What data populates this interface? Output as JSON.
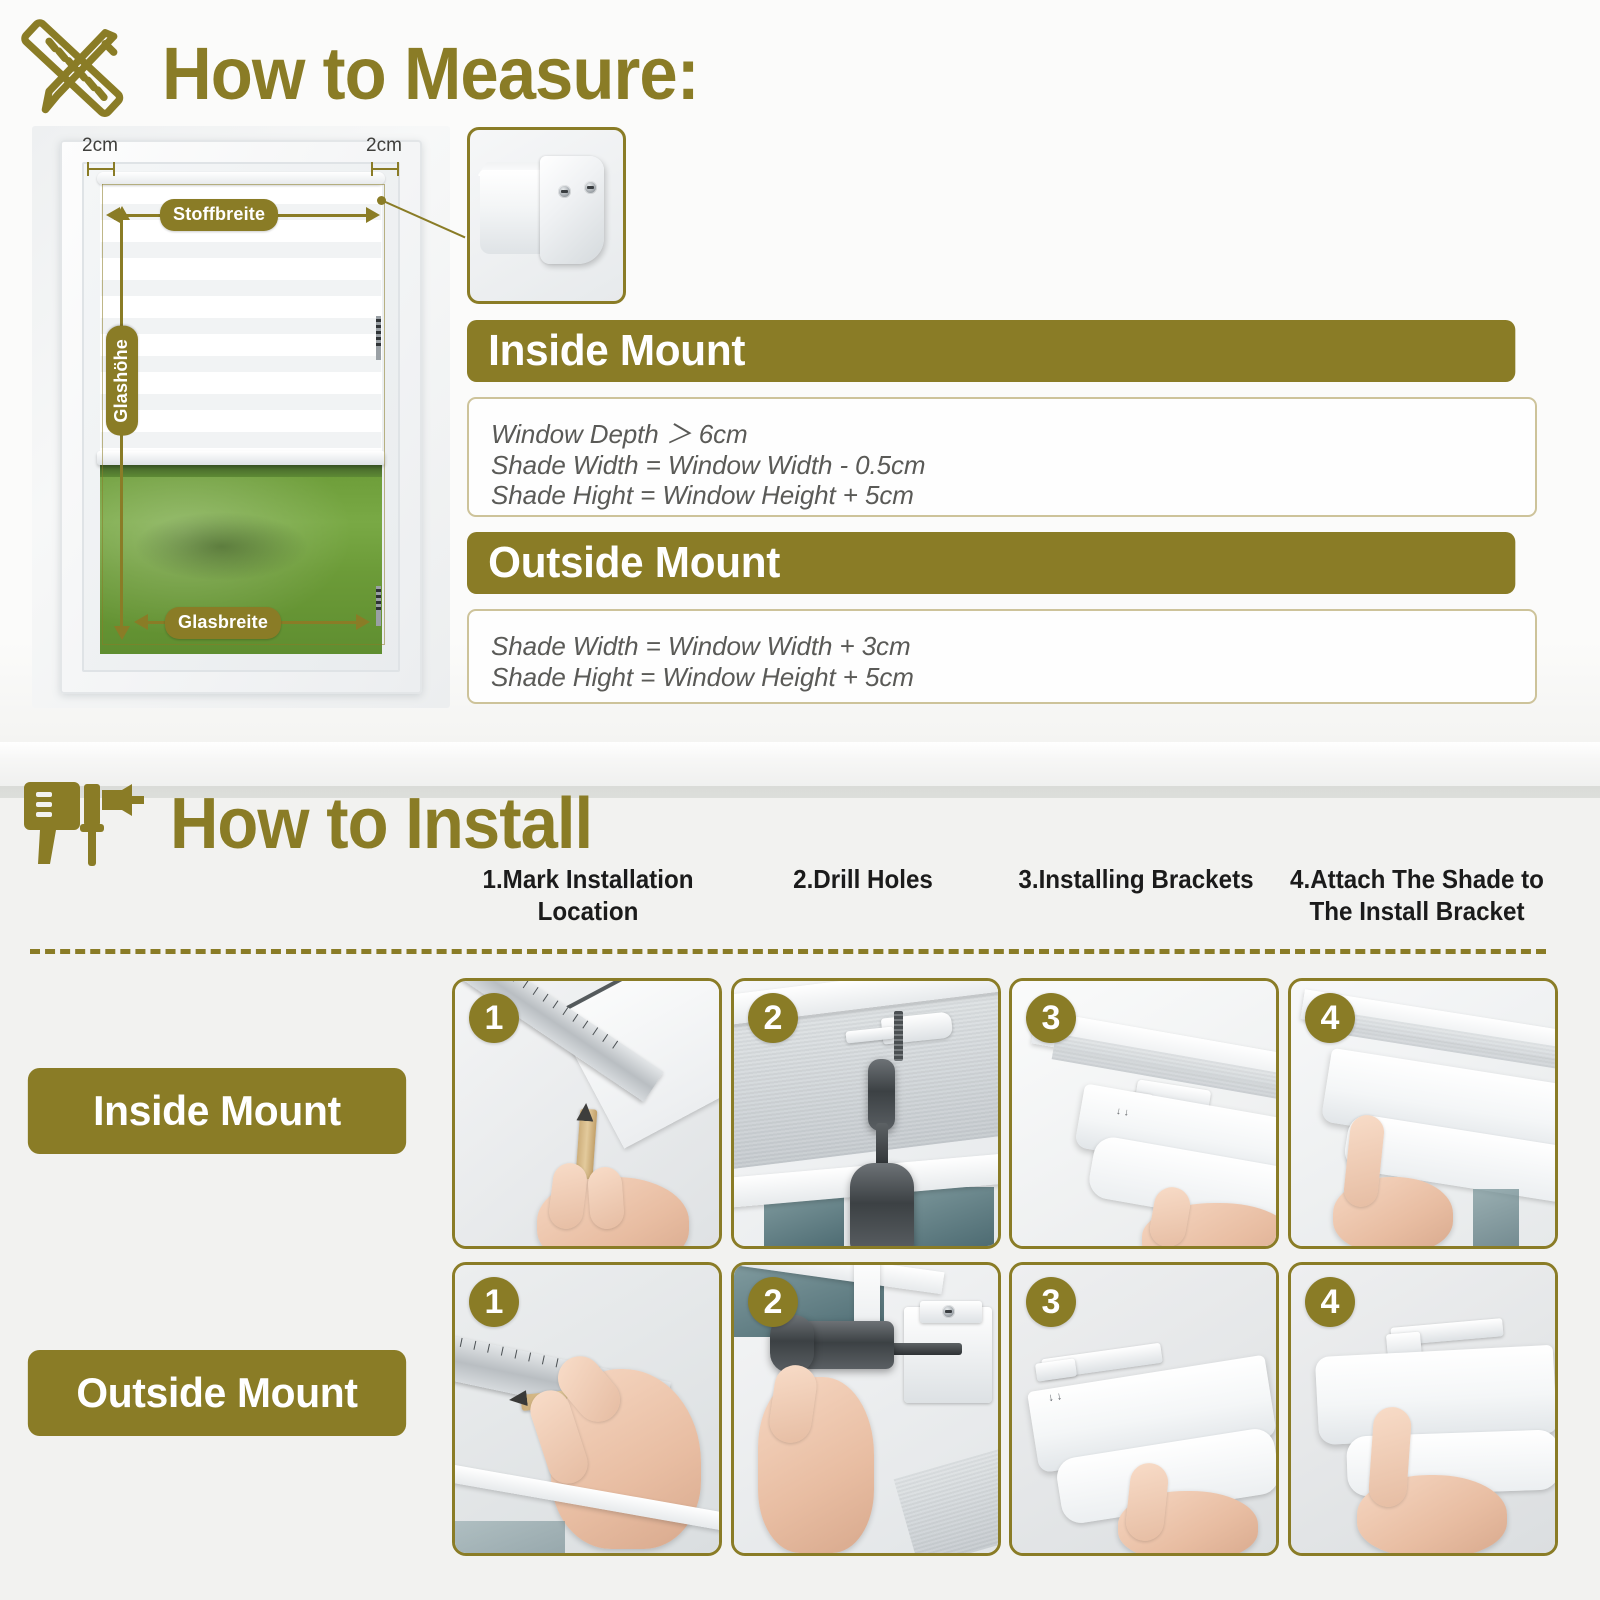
{
  "measure": {
    "title": "How to Measure:",
    "ruler_pencil_icon": "ruler-pencil-icon",
    "diagram": {
      "gap_left_label": "2cm",
      "gap_right_label": "2cm",
      "fabric_width_label": "Stoffbreite",
      "glass_height_label": "Glashöhe",
      "glass_width_label": "Glasbreite"
    },
    "bracket_closeup": "shade-end-cap-closeup",
    "inside_mount": {
      "heading": "Inside Mount",
      "lines": [
        "Window Depth ＞ 6cm",
        "Shade Width = Window Width - 0.5cm",
        "Shade Hight = Window Height + 5cm"
      ]
    },
    "outside_mount": {
      "heading": "Outside Mount",
      "lines": [
        "Shade Width = Window Width + 3cm",
        "Shade Hight = Window Height + 5cm"
      ]
    }
  },
  "install": {
    "title": "How to Install",
    "drill_icon": "drill-icon",
    "step_headers": [
      "1.Mark Installation\nLocation",
      "2.Drill Holes",
      "3.Installing\nBrackets",
      "4.Attach The Shade\nto The Install Bracket"
    ],
    "step_headers_flat": [
      "1.Mark Installation Location",
      "2.Drill Holes",
      "3.Installing Brackets",
      "4.Attach The Shade to The Install Bracket"
    ],
    "rows": [
      {
        "label": "Inside Mount",
        "badges": [
          "1",
          "2",
          "3",
          "4"
        ],
        "photo_alts": [
          "ruler-and-pencil-marking-inside-window-frame",
          "drill-driving-screw-into-window-top-frame",
          "bracket-installed-inside-window-recess",
          "hand-clipping-shade-into-install-bracket"
        ]
      },
      {
        "label": "Outside Mount",
        "badges": [
          "1",
          "2",
          "3",
          "4"
        ],
        "photo_alts": [
          "hand-marking-measurement-on-wall-with-ruler",
          "drill-fastening-bracket-to-wall-above-window",
          "hand-aligning-shade-headrail-with-wall-bracket",
          "hand-pressing-shade-into-mounted-bracket"
        ]
      }
    ]
  },
  "colors": {
    "brand_olive": "#8a7c26",
    "box_border": "#cdc39a",
    "body_text": "#5a5a57",
    "page_bg": "#f2f2f0"
  }
}
